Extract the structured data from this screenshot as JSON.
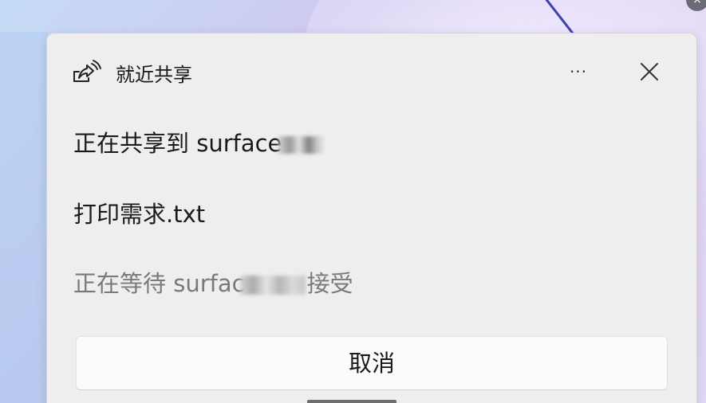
{
  "header": {
    "title": "就近共享",
    "more_label": "···",
    "icon": "nearby-share-icon",
    "close_icon": "close-icon"
  },
  "body": {
    "sharing_prefix": "正在共享到 surface",
    "file_name": "打印需求.txt",
    "waiting_prefix": "正在等待 surfac",
    "waiting_suffix": "接受"
  },
  "actions": {
    "cancel_label": "取消"
  },
  "desktop": {
    "corner_close": "×"
  }
}
